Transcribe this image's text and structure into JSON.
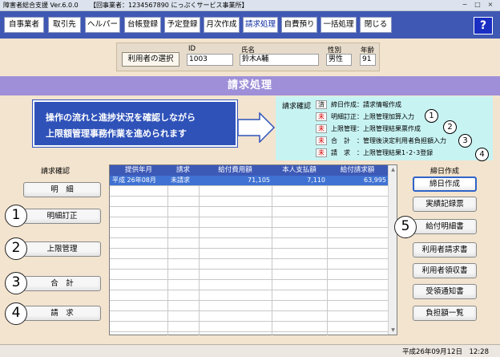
{
  "window": {
    "title": "障害者総合支援 Ver.6.0.0",
    "subtitle": "【回事業者：1234567890 にっぷくサービス事業所】",
    "controls": [
      "−",
      "□",
      "×"
    ]
  },
  "menu": {
    "items": [
      "自事業者",
      "取引先",
      "ヘルパー",
      "台帳登録",
      "予定登録",
      "月次作成",
      "請求処理",
      "自費預り",
      "一括処理",
      "閉じる"
    ],
    "active": "請求処理",
    "help": "?"
  },
  "user": {
    "select_button": "利用者の選択",
    "id_label": "ID",
    "id_value": "1003",
    "name_label": "氏名",
    "name_value": "鈴木A輔",
    "gender_label": "性別",
    "gender_value": "男性",
    "age_label": "年齢",
    "age_value": "91"
  },
  "section_title": "請求処理",
  "callout": {
    "line1": "操作の流れと進捗状況を確認しながら",
    "line2": "上限額管理事務作業を進められます"
  },
  "status": {
    "title": "請求確認",
    "rows": [
      {
        "badge": "済",
        "text": "締日作成：請求情報作成",
        "marker": ""
      },
      {
        "badge": "未",
        "text": "明細訂正：上限管理加算入力",
        "marker": "1"
      },
      {
        "badge": "未",
        "text": "上限管理：上限管理結果票作成",
        "marker": "2"
      },
      {
        "badge": "未",
        "text": "合　計　：管理後決定利用者負担額入力",
        "marker": "3"
      },
      {
        "badge": "未",
        "text": "請　求　：上限管理結果1･2･3登録",
        "marker": "4"
      }
    ]
  },
  "left_column": {
    "heading": "請求確認",
    "buttons": [
      "明　細",
      "明細訂正",
      "上限管理",
      "合　計",
      "請　求"
    ],
    "markers": [
      "1",
      "2",
      "3",
      "4"
    ]
  },
  "right_column": {
    "heading": "締日作成",
    "buttons": [
      "締日作成",
      "実績記録票",
      "給付明細書",
      "利用者請求書",
      "利用者領収書",
      "受領通知書",
      "負担額一覧"
    ],
    "marker": "5"
  },
  "table": {
    "columns": [
      "提供年月",
      "請求",
      "給付費用額",
      "本人支払額",
      "給付請求額"
    ],
    "rows": [
      [
        "平成 26年08月",
        "未請求",
        "71,105",
        "7,110",
        "63,995"
      ]
    ]
  },
  "statusbar": {
    "datetime": "平成26年09月12日　12:28"
  }
}
